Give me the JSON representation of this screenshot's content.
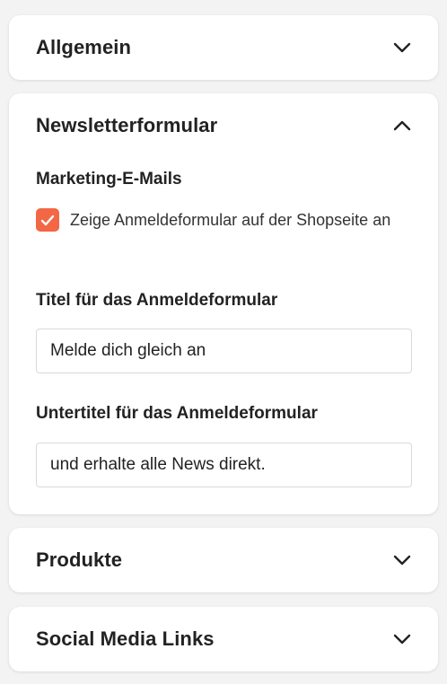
{
  "colors": {
    "accent": "#f26744",
    "card_background": "#ffffff",
    "page_background": "#f3f3f3",
    "input_border": "#d9d9d9"
  },
  "sections": {
    "allgemein": {
      "title": "Allgemein",
      "expanded": false,
      "icon": "chevron-down-icon"
    },
    "newsletter": {
      "title": "Newsletterformular",
      "expanded": true,
      "icon": "chevron-up-icon",
      "marketing_label": "Marketing-E-Mails",
      "checkbox": {
        "checked": true,
        "label": "Zeige Anmeldeformular auf der Shopseite an"
      },
      "title_field": {
        "label": "Titel für das Anmeldeformular",
        "value": "Melde dich gleich an"
      },
      "subtitle_field": {
        "label": "Untertitel für das Anmeldeformular",
        "value": "und erhalte alle News direkt."
      }
    },
    "produkte": {
      "title": "Produkte",
      "expanded": false,
      "icon": "chevron-down-icon"
    },
    "social": {
      "title": "Social Media Links",
      "expanded": false,
      "icon": "chevron-down-icon"
    }
  }
}
